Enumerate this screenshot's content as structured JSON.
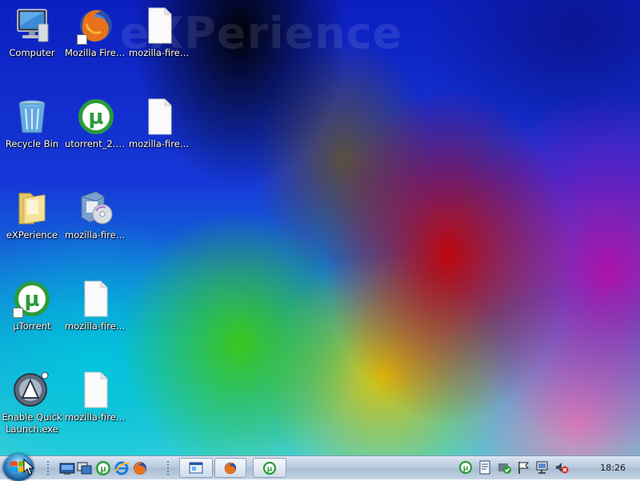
{
  "wallpaper": {
    "watermark": "eXPerience"
  },
  "desktop": {
    "icons": [
      {
        "label": "Computer"
      },
      {
        "label": "Mozilla Firefox"
      },
      {
        "label": "mozilla-firef..."
      },
      {
        "label": "Recycle Bin"
      },
      {
        "label": "utorrent_2.2...."
      },
      {
        "label": "mozilla-firef..."
      },
      {
        "label": "eXPerience"
      },
      {
        "label": "mozilla-firef..."
      },
      {
        "label": "µTorrent"
      },
      {
        "label": "mozilla-firef..."
      },
      {
        "label": "Enable Quick Launch.exe"
      },
      {
        "label": "mozilla-firef..."
      }
    ]
  },
  "taskbar": {
    "clock": "18:26",
    "quick_launch": [
      "show-desktop-icon",
      "switch-windows-icon",
      "utorrent-icon",
      "internet-explorer-icon",
      "firefox-icon"
    ],
    "tasks": [
      "explorer-window-icon",
      "firefox-icon",
      "utorrent-icon"
    ],
    "tray": [
      "utorrent-icon",
      "document-icon",
      "security-shield-icon",
      "action-center-flag-icon",
      "network-icon",
      "volume-muted-icon"
    ]
  },
  "colors": {
    "taskbar_top": "#dce6f2",
    "taskbar_bottom": "#a9bdd3",
    "utorrent_green": "#2a9b3a",
    "firefox_orange": "#e8721c"
  }
}
